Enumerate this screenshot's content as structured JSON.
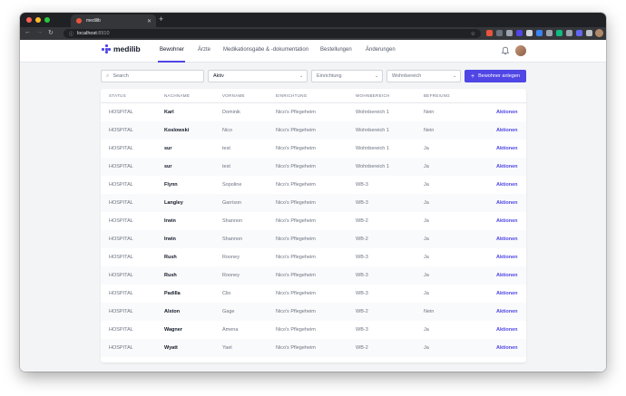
{
  "browser": {
    "tab_title": "medilib",
    "new_tab": "+",
    "url_host": "localhost",
    "url_port": ":8910"
  },
  "app": {
    "logo_text": "medilib",
    "nav": [
      {
        "label": "Bewohner",
        "active": true
      },
      {
        "label": "Ärzte",
        "active": false
      },
      {
        "label": "Medikationsgabe & -dokumentation",
        "active": false
      },
      {
        "label": "Bestellungen",
        "active": false
      },
      {
        "label": "Änderungen",
        "active": false
      }
    ]
  },
  "filters": {
    "search_placeholder": "Search",
    "status_value": "Aktiv",
    "facility_placeholder": "Einrichtung",
    "area_placeholder": "Wohnbereich",
    "add_button_label": "Bewohner anlegen"
  },
  "table": {
    "headers": [
      "STATUS",
      "NACHNAME",
      "VORNAME",
      "EINRICHTUNG",
      "WOHNBEREICH",
      "BEFREIUNG"
    ],
    "action_label": "Aktionen",
    "rows": [
      [
        "HOSPITAL",
        "Karl",
        "Dominik",
        "Nico's Pflegeheim",
        "Wohnbereich 1",
        "Nein"
      ],
      [
        "HOSPITAL",
        "Koslowski",
        "Nico",
        "Nico's Pflegeheim",
        "Wohnbereich 1",
        "Nein"
      ],
      [
        "HOSPITAL",
        "sur",
        "test",
        "Nico's Pflegeheim",
        "Wohnbereich 1",
        "Ja"
      ],
      [
        "HOSPITAL",
        "sur",
        "test",
        "Nico's Pflegeheim",
        "Wohnbereich 1",
        "Ja"
      ],
      [
        "HOSPITAL",
        "Flynn",
        "Sopoline",
        "Nico's Pflegeheim",
        "WB-3",
        "Ja"
      ],
      [
        "HOSPITAL",
        "Langley",
        "Garrison",
        "Nico's Pflegeheim",
        "WB-3",
        "Ja"
      ],
      [
        "HOSPITAL",
        "Irwin",
        "Shannon",
        "Nico's Pflegeheim",
        "WB-2",
        "Ja"
      ],
      [
        "HOSPITAL",
        "Irwin",
        "Shannon",
        "Nico's Pflegeheim",
        "WB-2",
        "Ja"
      ],
      [
        "HOSPITAL",
        "Rush",
        "Rooney",
        "Nico's Pflegeheim",
        "WB-3",
        "Ja"
      ],
      [
        "HOSPITAL",
        "Rush",
        "Rooney",
        "Nico's Pflegeheim",
        "WB-3",
        "Ja"
      ],
      [
        "HOSPITAL",
        "Padilla",
        "Clio",
        "Nico's Pflegeheim",
        "WB-3",
        "Ja"
      ],
      [
        "HOSPITAL",
        "Alston",
        "Gage",
        "Nico's Pflegeheim",
        "WB-2",
        "Nein"
      ],
      [
        "HOSPITAL",
        "Wagner",
        "Amena",
        "Nico's Pflegeheim",
        "WB-3",
        "Ja"
      ],
      [
        "HOSPITAL",
        "Wyatt",
        "Yael",
        "Nico's Pflegeheim",
        "WB-2",
        "Ja"
      ]
    ]
  },
  "colors": {
    "accent": "#4f46e5",
    "favicon": "#e8553b"
  },
  "icons": {
    "search": "search-icon",
    "bell": "bell-icon",
    "chevron": "chevron-down-icon",
    "plus": "plus-icon"
  }
}
